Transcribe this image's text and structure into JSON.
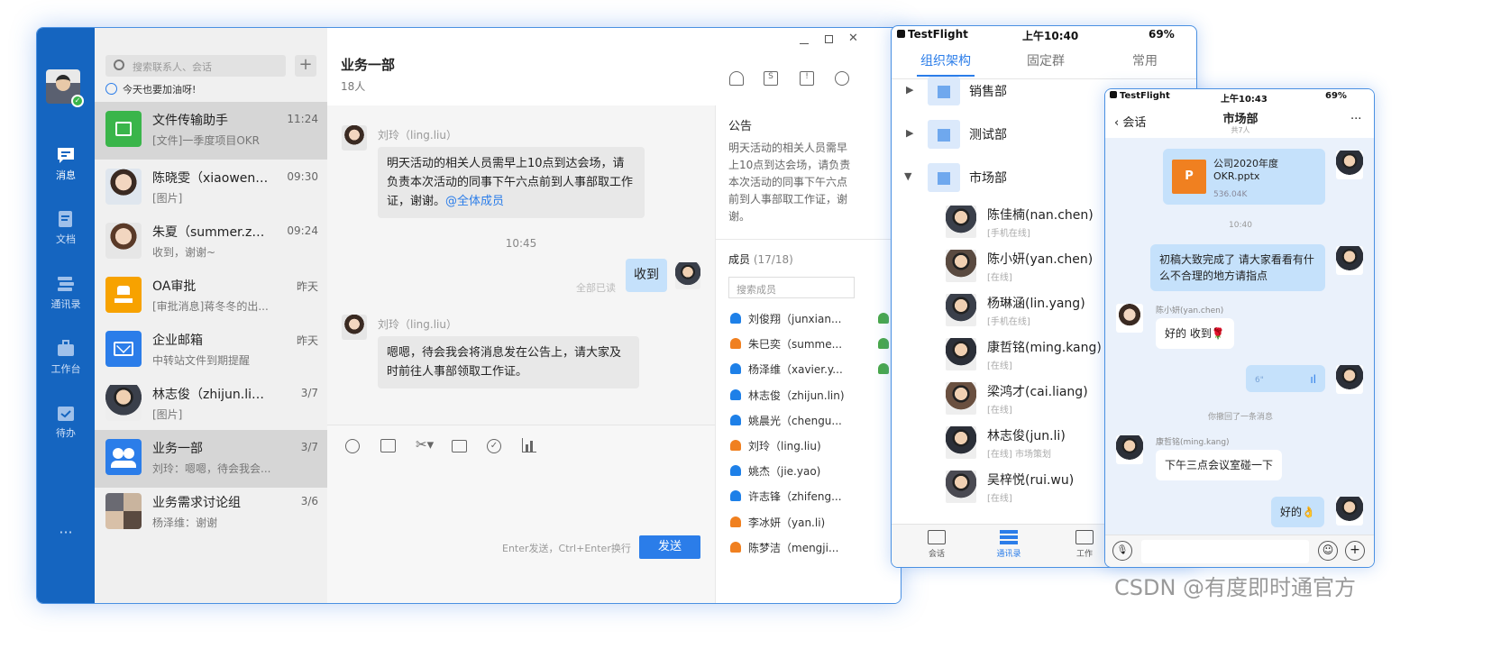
{
  "desktop": {
    "rail": {
      "items": [
        {
          "label": "消息",
          "icon": "message-icon"
        },
        {
          "label": "文档",
          "icon": "document-icon"
        },
        {
          "label": "通讯录",
          "icon": "contacts-icon"
        },
        {
          "label": "工作台",
          "icon": "briefcase-icon"
        },
        {
          "label": "待办",
          "icon": "todo-icon"
        }
      ],
      "more": "···"
    },
    "search_placeholder": "搜索联系人、会话",
    "plus": "+",
    "status_text": "今天也要加油呀!",
    "conversations": [
      {
        "name": "文件传输助手",
        "time": "11:24",
        "preview": "[文件]一季度项目OKR"
      },
      {
        "name": "陈晓雯（xiaowen.c...",
        "time": "09:30",
        "preview": "[图片]"
      },
      {
        "name": "朱夏（summer.zh...",
        "time": "09:24",
        "preview": "收到，谢谢~"
      },
      {
        "name": "OA审批",
        "time": "昨天",
        "preview": "[审批消息]蒋冬冬的出..."
      },
      {
        "name": "企业邮箱",
        "time": "昨天",
        "preview": "中转站文件到期提醒"
      },
      {
        "name": "林志俊（zhijun.lin...",
        "time": "3/7",
        "preview": "[图片]"
      },
      {
        "name": "业务一部",
        "time": "3/7",
        "preview": "刘玲：嗯嗯，待会我会..."
      },
      {
        "name": "业务需求讨论组",
        "time": "3/6",
        "preview": "杨泽维：谢谢"
      }
    ],
    "chat": {
      "title": "业务一部",
      "subtitle": "18人",
      "messages": [
        {
          "sender": "刘玲（ling.liu）",
          "text": "明天活动的相关人员需早上10点到达会场，请负责本次活动的同事下午六点前到人事部取工作证，谢谢。",
          "mention": "@全体成员"
        },
        {
          "time": "10:45"
        },
        {
          "read": "全部已读",
          "text": "收到"
        },
        {
          "sender": "刘玲（ling.liu）",
          "text": "嗯嗯，待会我会将消息发在公告上，请大家及时前往人事部领取工作证。"
        }
      ],
      "hint": "Enter发送，Ctrl+Enter换行",
      "send": "发送"
    },
    "side": {
      "notice_title": "公告",
      "notice": "明天活动的相关人员需早上10点到达会场，请负责本次活动的同事下午六点前到人事部取工作证，谢谢。",
      "members_title": "成员",
      "members_count": "(17/18)",
      "member_search": "搜索成员",
      "members": [
        {
          "name": "刘俊翔（junxian...",
          "color": "#1e80e8",
          "badge": true
        },
        {
          "name": "朱巳奕（summe...",
          "color": "#f08020",
          "badge": true
        },
        {
          "name": "杨泽维（xavier.y...",
          "color": "#1e80e8",
          "badge": true
        },
        {
          "name": "林志俊（zhijun.lin)",
          "color": "#1e80e8",
          "badge": false
        },
        {
          "name": "姚晨光（chengu...",
          "color": "#1e80e8",
          "badge": false
        },
        {
          "name": "刘玲（ling.liu)",
          "color": "#f08020",
          "badge": false
        },
        {
          "name": "姚杰（jie.yao)",
          "color": "#1e80e8",
          "badge": false
        },
        {
          "name": "许志锋（zhifeng...",
          "color": "#1e80e8",
          "badge": false
        },
        {
          "name": "李冰妍（yan.li)",
          "color": "#f08020",
          "badge": false
        },
        {
          "name": "陈梦洁（mengji...",
          "color": "#f08020",
          "badge": false
        }
      ]
    }
  },
  "phone1": {
    "status": {
      "app": "TestFlight",
      "time": "上午10:40",
      "battery": "69%"
    },
    "tabs": [
      "组织架构",
      "固定群",
      "常用"
    ],
    "departments": [
      "销售部",
      "测试部",
      "市场部"
    ],
    "people": [
      {
        "name": "陈佳楠(nan.chen)",
        "status": "[手机在线]"
      },
      {
        "name": "陈小妍(yan.chen)",
        "status": "[在线]"
      },
      {
        "name": "杨琳涵(lin.yang)",
        "status": "[手机在线]"
      },
      {
        "name": "康哲铭(ming.kang)",
        "status": "[在线]"
      },
      {
        "name": "梁鸿才(cai.liang)",
        "status": "[在线]"
      },
      {
        "name": "林志俊(jun.li)",
        "status": "[在线] 市场策划"
      },
      {
        "name": "吴梓悦(rui.wu)",
        "status": "[在线]"
      }
    ],
    "bottom": [
      "会话",
      "通讯录",
      "工作"
    ]
  },
  "phone2": {
    "status": {
      "app": "TestFlight",
      "time": "上午10:43",
      "battery": "69%"
    },
    "back": "会话",
    "title": "市场部",
    "subtitle": "共7人",
    "more": "···",
    "file": {
      "name": "公司2020年度OKR.pptx",
      "size": "536.04K"
    },
    "time": "10:40",
    "msg1": "初稿大致完成了 请大家看看有什么不合理的地方请指点",
    "sender2": "陈小妍(yan.chen)",
    "msg2": "好的 收到🌹",
    "voice": "6\"",
    "recall": "你撤回了一条消息",
    "sender3": "康哲铭(ming.kang)",
    "msg3": "下午三点会议室碰一下",
    "msg4": "好的👌"
  },
  "watermark": "CSDN @有度即时通官方"
}
